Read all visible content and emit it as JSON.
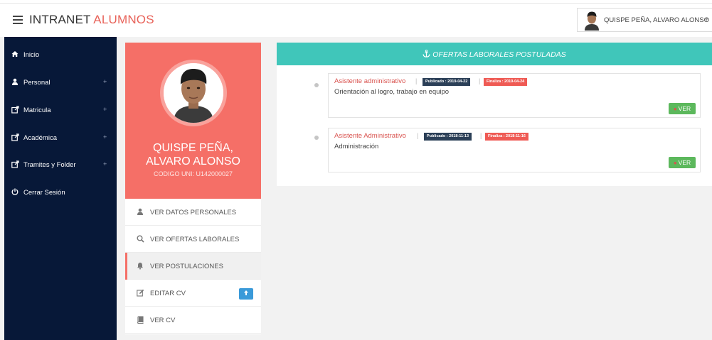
{
  "header": {
    "brand_main": "INTRANET",
    "brand_accent": "ALUMNOS",
    "user_name": "QUISPE PEÑA, ALVARO ALONSO"
  },
  "sidebar": {
    "items": [
      {
        "label": "Inicio",
        "icon": "home-icon",
        "expandable": false
      },
      {
        "label": "Personal",
        "icon": "user-icon",
        "expandable": true
      },
      {
        "label": "Matricula",
        "icon": "external-link-icon",
        "expandable": true
      },
      {
        "label": "Académica",
        "icon": "external-link-icon",
        "expandable": true
      },
      {
        "label": "Tramites y Folder",
        "icon": "external-link-icon",
        "expandable": true
      },
      {
        "label": "Cerrar Sesión",
        "icon": "power-icon",
        "expandable": false
      }
    ],
    "plus_symbol": "+"
  },
  "profile": {
    "name_line1": "QUISPE PEÑA,",
    "name_line2": "ALVARO ALONSO",
    "code": "CODIGO UNI: U142000027"
  },
  "profile_menu": [
    {
      "label": "VER DATOS PERSONALES",
      "icon": "user-icon",
      "active": false
    },
    {
      "label": "VER OFERTAS LABORALES",
      "icon": "search-icon",
      "active": false
    },
    {
      "label": "VER POSTULACIONES",
      "icon": "bell-icon",
      "active": true
    },
    {
      "label": "EDITAR CV",
      "icon": "edit-icon",
      "active": false
    },
    {
      "label": "VER CV",
      "icon": "book-icon",
      "active": false
    }
  ],
  "offers_panel": {
    "title": "OFERTAS LABORALES POSTULADAS",
    "jobs": [
      {
        "title": "Asistente administrativo",
        "published": "Publicado : 2019-04-22",
        "ends": "Finaliza : 2019-04-24",
        "description": "Orientación al logro, trabajo en equipo",
        "button": "VER"
      },
      {
        "title": "Asistente Administrativo",
        "published": "Publicado : 2018-11-13",
        "ends": "Finaliza : 2018-11-16",
        "description": "Administración",
        "button": "VER"
      }
    ]
  },
  "colors": {
    "sidebar": "#071838",
    "profile_card": "#f56f67",
    "panel_header": "#40c6ba",
    "badge_published": "#2b3f57",
    "badge_ends": "#ef5a54",
    "ver_button": "#5cb85c"
  }
}
